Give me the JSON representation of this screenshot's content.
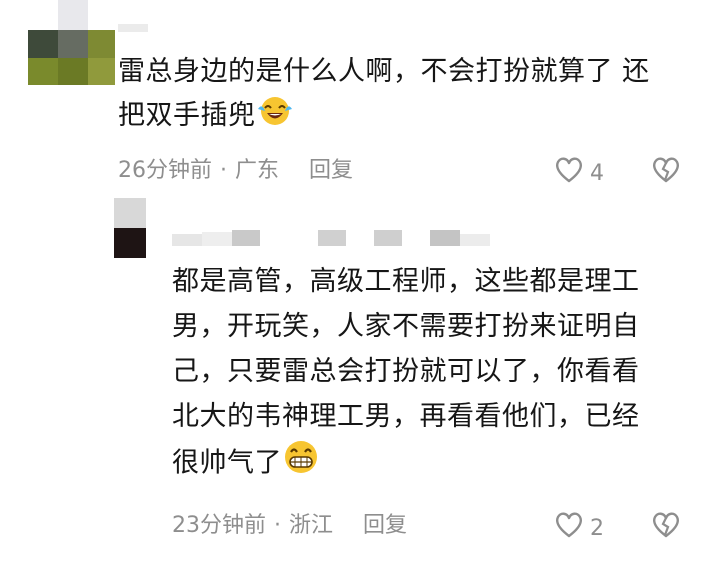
{
  "comments": [
    {
      "text_line1": "雷总身边的是什么人啊，不会打扮就算了 还",
      "text_line2": "把双手插兜",
      "emoji": "laughing-crying-emoji",
      "time": "26分钟前",
      "location": "广东",
      "reply_label": "回复",
      "likes": "4"
    }
  ],
  "replies": [
    {
      "lines": [
        "都是高管，高级工程师，这些都是理工",
        "男，开玩笑，人家不需要打扮来证明自",
        "己，只要雷总会打扮就可以了，你看看",
        "北大的韦神理工男，再看看他们，已经",
        "很帅气了"
      ],
      "emoji": "grinning-emoji",
      "time": "23分钟前",
      "location": "浙江",
      "reply_label": "回复",
      "likes": "2"
    }
  ],
  "icons": {
    "like": "heart-outline-icon",
    "dislike": "broken-heart-icon"
  },
  "colors": {
    "text": "#161616",
    "meta": "#8e8e8e",
    "emoji_yellow": "#f7c531"
  }
}
